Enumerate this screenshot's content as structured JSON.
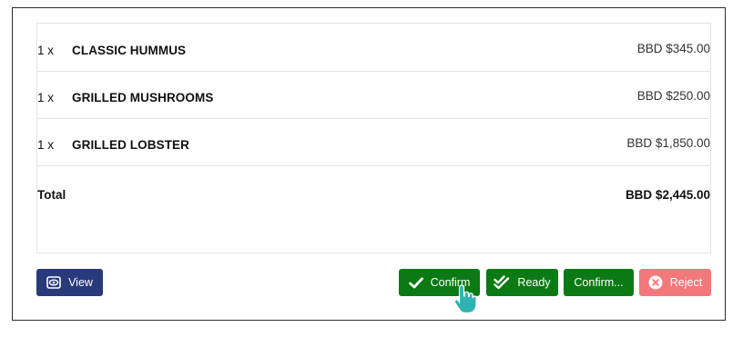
{
  "order": {
    "items": [
      {
        "qty": "1 x",
        "name": "CLASSIC HUMMUS",
        "price": "BBD $345.00"
      },
      {
        "qty": "1 x",
        "name": "GRILLED MUSHROOMS",
        "price": "BBD $250.00"
      },
      {
        "qty": "1 x",
        "name": "GRILLED LOBSTER",
        "price": "BBD $1,850.00"
      }
    ],
    "total_label": "Total",
    "total_value": "BBD $2,445.00"
  },
  "actions": {
    "view_label": "View",
    "confirm_label": "Confirm",
    "ready_label": "Ready",
    "confirm_more_label": "Confirm...",
    "reject_label": "Reject"
  },
  "icons": {
    "view": "eye-icon",
    "confirm": "check-icon",
    "ready": "double-check-icon",
    "reject": "close-circle-icon",
    "cursor": "hand-pointer-icon"
  },
  "colors": {
    "view": "#283a7a",
    "confirm": "#0b7a14",
    "reject": "#f2787c"
  }
}
